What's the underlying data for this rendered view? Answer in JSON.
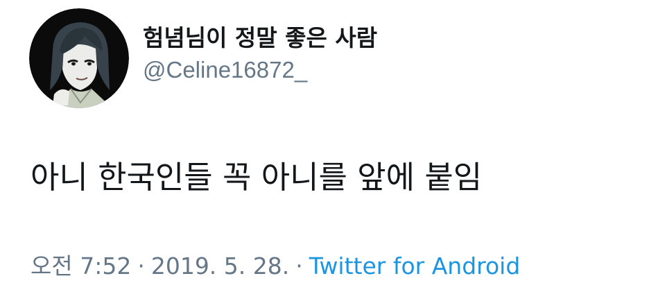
{
  "user": {
    "display_name": "험념님이 정말 좋은 사람",
    "handle": "@Celine16872_"
  },
  "tweet": {
    "text": "아니 한국인들 꼭 아니를 앞에 붙임",
    "time": "오전 7:52",
    "separator": "·",
    "date": "2019. 5. 28.",
    "source": "Twitter for Android"
  },
  "colors": {
    "text": "#14171a",
    "secondary": "#657786",
    "link": "#1b95e0"
  },
  "icons": {
    "avatar": "profile-avatar-illustration"
  }
}
